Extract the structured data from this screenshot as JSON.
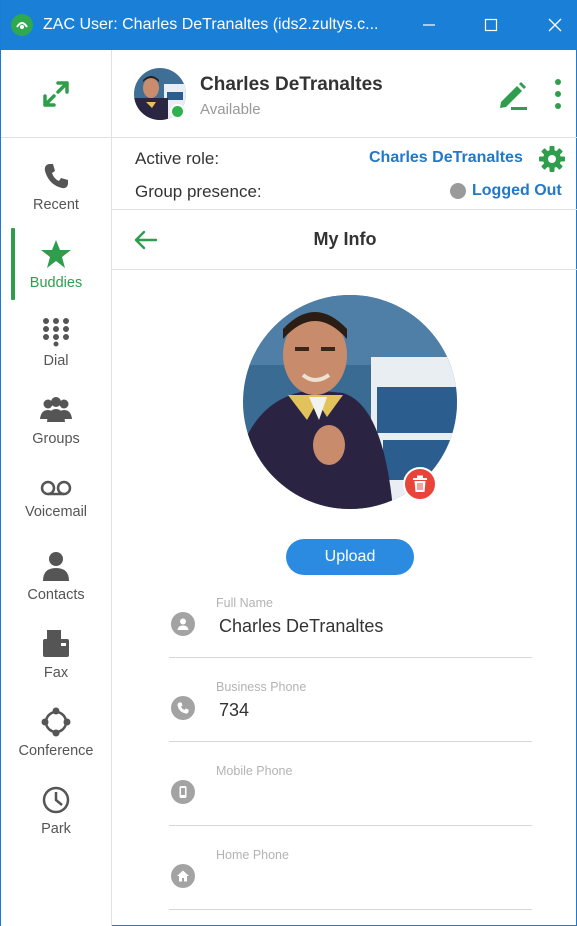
{
  "window": {
    "title": "ZAC User: Charles DeTranaltes (ids2.zultys.c...",
    "minimize_glyph": "—",
    "maximize_glyph": "☐",
    "close_glyph": "✕"
  },
  "colors": {
    "titlebar": "#1a7fd6",
    "accent_green": "#2e9e4c",
    "link_blue": "#2179c9",
    "upload_blue": "#2a8be0",
    "delete_red": "#e8443a"
  },
  "sidebar": {
    "expand_icon": "expand-arrows-icon",
    "items": [
      {
        "label": "Recent",
        "icon": "phone-icon",
        "active": false
      },
      {
        "label": "Buddies",
        "icon": "star-icon",
        "active": true
      },
      {
        "label": "Dial",
        "icon": "dialpad-icon",
        "active": false
      },
      {
        "label": "Groups",
        "icon": "group-icon",
        "active": false
      },
      {
        "label": "Voicemail",
        "icon": "voicemail-icon",
        "active": false
      },
      {
        "label": "Contacts",
        "icon": "contact-icon",
        "active": false
      },
      {
        "label": "Fax",
        "icon": "fax-icon",
        "active": false
      },
      {
        "label": "Conference",
        "icon": "conference-icon",
        "active": false
      },
      {
        "label": "Park",
        "icon": "clock-icon",
        "active": false
      }
    ]
  },
  "header": {
    "name": "Charles DeTranaltes",
    "status": "Available",
    "status_color": "#2eb24f"
  },
  "roles": {
    "active_role_label": "Active role:",
    "active_role_value": "Charles DeTranaltes",
    "group_presence_label": "Group presence:",
    "group_presence_value": "Logged Out"
  },
  "my_info": {
    "title": "My Info",
    "upload_label": "Upload",
    "fields": [
      {
        "label": "Full Name",
        "value": "Charles DeTranaltes",
        "icon": "person-icon"
      },
      {
        "label": "Business Phone",
        "value": "734",
        "icon": "phone-icon"
      },
      {
        "label": "Mobile Phone",
        "value": "",
        "icon": "mobile-icon"
      },
      {
        "label": "Home Phone",
        "value": "",
        "icon": "home-icon"
      }
    ]
  }
}
